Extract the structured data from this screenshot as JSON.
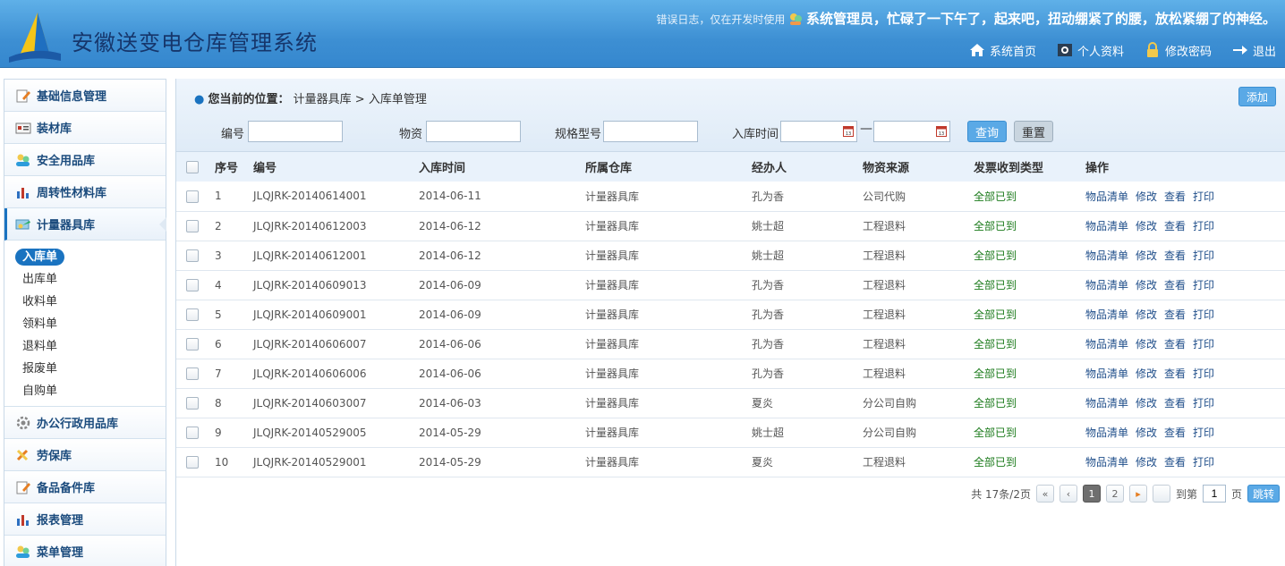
{
  "header": {
    "title": "安徽送变电仓库管理系统",
    "error_log": "错误日志，仅在开发时使用",
    "greeting": "系统管理员，忙碌了一下午了，起来吧，扭动绷紧了的腰，放松紧绷了的神经。",
    "nav": [
      {
        "label": "系统首页",
        "icon": "home-icon"
      },
      {
        "label": "个人资料",
        "icon": "profile-icon"
      },
      {
        "label": "修改密码",
        "icon": "lock-icon"
      },
      {
        "label": "退出",
        "icon": "logout-icon"
      }
    ]
  },
  "sidebar": {
    "items": [
      {
        "label": "基础信息管理",
        "icon": "edit-icon"
      },
      {
        "label": "装材库",
        "icon": "card-icon"
      },
      {
        "label": "安全用品库",
        "icon": "users-icon"
      },
      {
        "label": "周转性材料库",
        "icon": "bar-chart-icon"
      },
      {
        "label": "计量器具库",
        "icon": "tools-icon"
      }
    ],
    "subitems": [
      "入库单",
      "出库单",
      "收料单",
      "领料单",
      "退料单",
      "报废单",
      "自购单"
    ],
    "items_after": [
      {
        "label": "办公行政用品库",
        "icon": "gear-icon"
      },
      {
        "label": "劳保库",
        "icon": "wrench-icon"
      },
      {
        "label": "备品备件库",
        "icon": "edit-icon"
      },
      {
        "label": "报表管理",
        "icon": "bar-chart-icon"
      },
      {
        "label": "菜单管理",
        "icon": "users-icon"
      }
    ]
  },
  "breadcrumb": {
    "prefix": "您当前的位置：",
    "level1": "计量器具库",
    "sep": ">",
    "level2": "入库单管理"
  },
  "add_label": "添加",
  "filters": {
    "code_label": "编号",
    "material_label": "物资",
    "spec_label": "规格型号",
    "date_label": "入库时间",
    "date_sep": "—",
    "query_label": "查询",
    "reset_label": "重置"
  },
  "table": {
    "headers": [
      "序号",
      "编号",
      "入库时间",
      "所属仓库",
      "经办人",
      "物资来源",
      "发票收到类型",
      "操作"
    ],
    "rows": [
      [
        "1",
        "JLQJRK-20140614001",
        "2014-06-11",
        "计量器具库",
        "孔为香",
        "公司代购",
        "全部已到"
      ],
      [
        "2",
        "JLQJRK-20140612003",
        "2014-06-12",
        "计量器具库",
        "姚士超",
        "工程退料",
        "全部已到"
      ],
      [
        "3",
        "JLQJRK-20140612001",
        "2014-06-12",
        "计量器具库",
        "姚士超",
        "工程退料",
        "全部已到"
      ],
      [
        "4",
        "JLQJRK-20140609013",
        "2014-06-09",
        "计量器具库",
        "孔为香",
        "工程退料",
        "全部已到"
      ],
      [
        "5",
        "JLQJRK-20140609001",
        "2014-06-09",
        "计量器具库",
        "孔为香",
        "工程退料",
        "全部已到"
      ],
      [
        "6",
        "JLQJRK-20140606007",
        "2014-06-06",
        "计量器具库",
        "孔为香",
        "工程退料",
        "全部已到"
      ],
      [
        "7",
        "JLQJRK-20140606006",
        "2014-06-06",
        "计量器具库",
        "孔为香",
        "工程退料",
        "全部已到"
      ],
      [
        "8",
        "JLQJRK-20140603007",
        "2014-06-03",
        "计量器具库",
        "夏炎",
        "分公司自购",
        "全部已到"
      ],
      [
        "9",
        "JLQJRK-20140529005",
        "2014-05-29",
        "计量器具库",
        "姚士超",
        "分公司自购",
        "全部已到"
      ],
      [
        "10",
        "JLQJRK-20140529001",
        "2014-05-29",
        "计量器具库",
        "夏炎",
        "工程退料",
        "全部已到"
      ]
    ],
    "actions": [
      "物品清单",
      "修改",
      "查看",
      "打印"
    ]
  },
  "pager": {
    "summary": "共 17条/2页",
    "pages": [
      "1",
      "2"
    ],
    "goto_prefix": "到第",
    "goto_value": "1",
    "goto_suffix": "页",
    "go_label": "跳转"
  },
  "colors": {
    "header_blue": "#3d8fd3",
    "accent": "#1a73c0",
    "status_green": "#1a7a1a",
    "link": "#1f4e8a"
  }
}
